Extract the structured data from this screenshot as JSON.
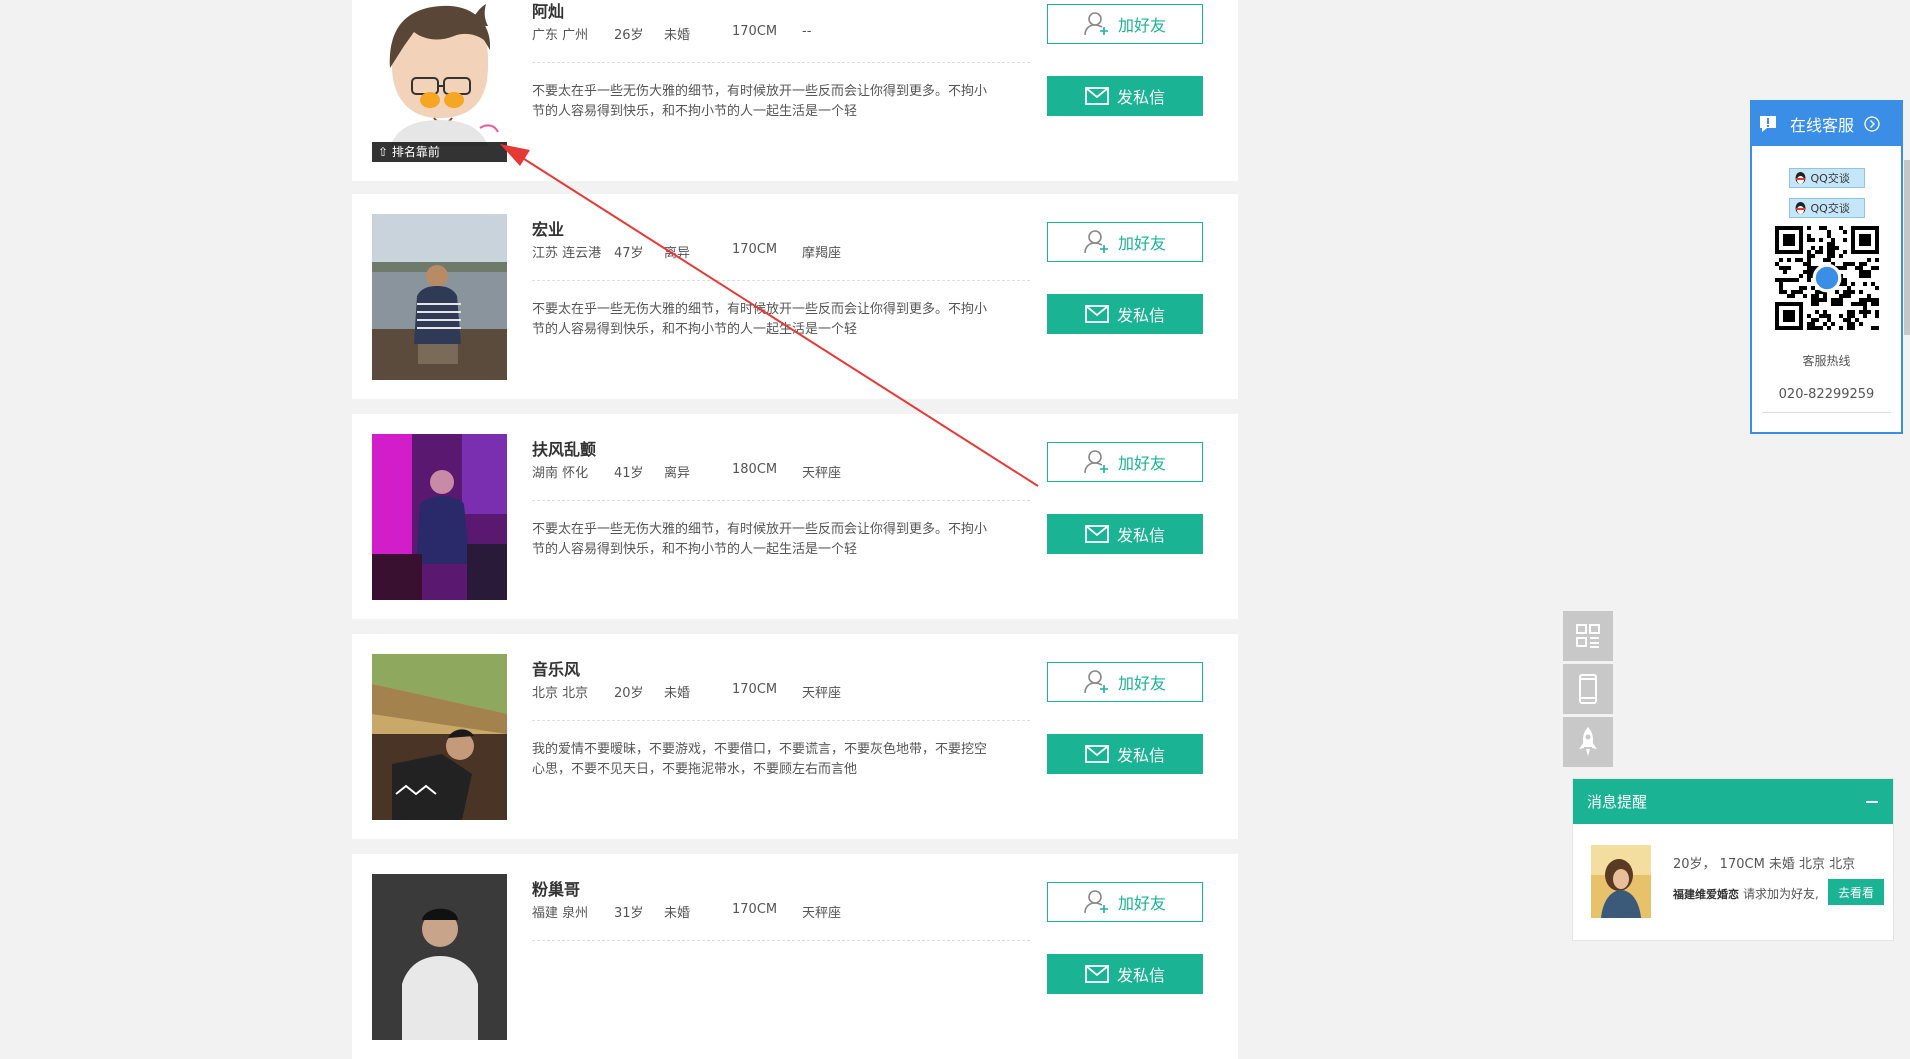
{
  "members": [
    {
      "name": "阿灿",
      "location": "广东 广州",
      "age": "26岁",
      "marital": "未婚",
      "height": "170CM",
      "sign": "--",
      "bio": "不要太在乎一些无伤大雅的细节，有时候放开一些反而会让你得到更多。不拘小节的人容易得到快乐，和不拘小节的人一起生活是一个轻",
      "rank_tag": "排名靠前"
    },
    {
      "name": "宏业",
      "location": "江苏 连云港",
      "age": "47岁",
      "marital": "离异",
      "height": "170CM",
      "sign": "摩羯座",
      "bio": "不要太在乎一些无伤大雅的细节，有时候放开一些反而会让你得到更多。不拘小节的人容易得到快乐，和不拘小节的人一起生活是一个轻"
    },
    {
      "name": "扶风乱颤",
      "location": "湖南 怀化",
      "age": "41岁",
      "marital": "离异",
      "height": "180CM",
      "sign": "天秤座",
      "bio": "不要太在乎一些无伤大雅的细节，有时候放开一些反而会让你得到更多。不拘小节的人容易得到快乐，和不拘小节的人一起生活是一个轻"
    },
    {
      "name": "音乐风",
      "location": "北京 北京",
      "age": "20岁",
      "marital": "未婚",
      "height": "170CM",
      "sign": "天秤座",
      "bio": "我的爱情不要暧昧，不要游戏，不要借口，不要谎言，不要灰色地带，不要挖空心思，不要不见天日，不要拖泥带水，不要顾左右而言他"
    },
    {
      "name": "粉巢哥",
      "location": "福建 泉州",
      "age": "31岁",
      "marital": "未婚",
      "height": "170CM",
      "sign": "天秤座",
      "bio": ""
    }
  ],
  "buttons": {
    "add_friend": "加好友",
    "send_message": "发私信"
  },
  "service": {
    "title": "在线客服",
    "qq1": "QQ交谈",
    "qq2": "QQ交谈",
    "hotline_label": "客服热线",
    "hotline": "020-82299259"
  },
  "notify": {
    "title": "消息提醒",
    "info": "20岁， 170CM 未婚 北京 北京",
    "from": "福建维爱婚恋",
    "action_text": "请求加为好友,",
    "button": "去看看"
  },
  "colors": {
    "accent": "#1ab394",
    "service_blue": "#3a8ee6",
    "arrow": "#e53935"
  }
}
